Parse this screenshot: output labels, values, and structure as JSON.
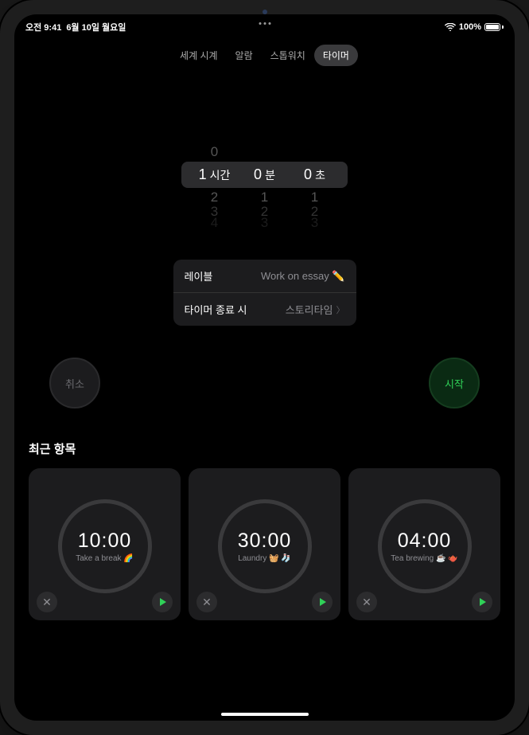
{
  "status_bar": {
    "time": "오전 9:41",
    "date": "6월 10일 월요일",
    "battery_pct": "100%"
  },
  "tabs": {
    "world_clock": "세계 시계",
    "alarm": "알람",
    "stopwatch": "스톱워치",
    "timer": "타이머"
  },
  "picker": {
    "hour_value": "1",
    "hour_unit": "시간",
    "min_value": "0",
    "min_unit": "분",
    "sec_value": "0",
    "sec_unit": "초",
    "ghost_above_hour": "0",
    "ghost_below1": {
      "h": "2",
      "m": "1",
      "s": "1"
    },
    "ghost_below2": {
      "h": "3",
      "m": "2",
      "s": "2"
    },
    "ghost_below3": {
      "h": "4",
      "m": "3",
      "s": "3"
    }
  },
  "settings": {
    "label_key": "레이블",
    "label_value": "Work on essay ✏️",
    "end_key": "타이머 종료 시",
    "end_value": "스토리타임"
  },
  "actions": {
    "cancel": "취소",
    "start": "시작"
  },
  "recents": {
    "title": "최근 항목",
    "items": [
      {
        "time": "10:00",
        "label": "Take a break 🌈"
      },
      {
        "time": "30:00",
        "label": "Laundry 🧺 🧦"
      },
      {
        "time": "04:00",
        "label": "Tea brewing ☕️ 🫖"
      }
    ]
  }
}
